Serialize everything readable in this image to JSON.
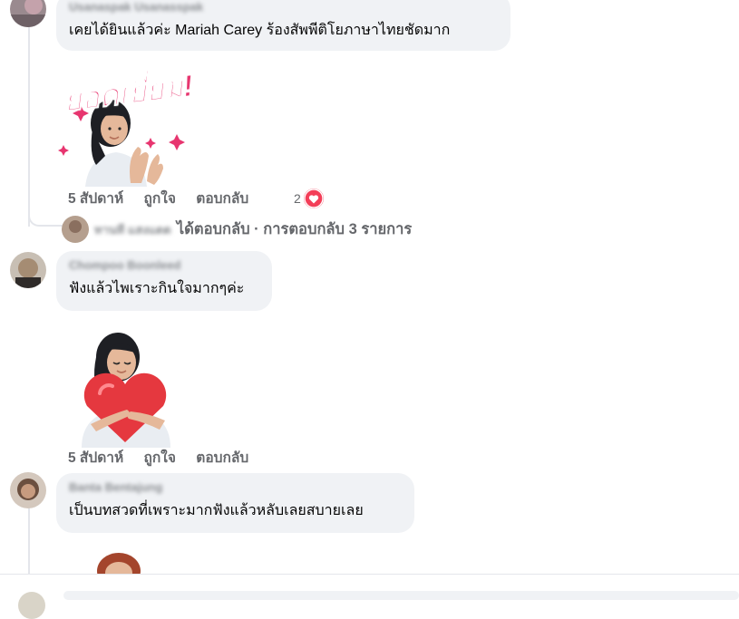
{
  "colors": {
    "bubble_bg": "#f0f2f5",
    "action_text": "#65676b",
    "thread_line": "#e4e6eb",
    "love_reaction": "#f33e58",
    "sticker_text": "#e7356f"
  },
  "comments": [
    {
      "author": "Usanaspak Usanasspak",
      "text": "เคยได้ยินแล้วค่ะ Mariah Carey ร้องสัพพีติโยภาษาไทยชัดมาก",
      "sticker": {
        "caption": "ยอดเยี่ยม!",
        "icon": "woman-clapping-sticker"
      },
      "time": "5 สัปดาห์",
      "like": "ถูกใจ",
      "reply": "ตอบกลับ",
      "reaction_count": "2",
      "reaction_icon": "heart-icon",
      "replies": {
        "replier": "ทานที แสงแดด",
        "summary": "ได้ตอบกลับ · การตอบกลับ 3 รายการ"
      }
    },
    {
      "author": "Chompoo Boonleed",
      "text": "ฟังแล้วไพเราะกินใจมากๆค่ะ",
      "sticker": {
        "caption": "",
        "icon": "woman-hugging-heart-sticker"
      },
      "time": "5 สัปดาห์",
      "like": "ถูกใจ",
      "reply": "ตอบกลับ"
    },
    {
      "author": "Banta Bentajung",
      "text": "เป็นบทสวดที่เพราะมากฟังแล้วหลับเลยสบายเลย",
      "sticker": {
        "caption": "",
        "icon": "partial-sticker"
      }
    }
  ]
}
